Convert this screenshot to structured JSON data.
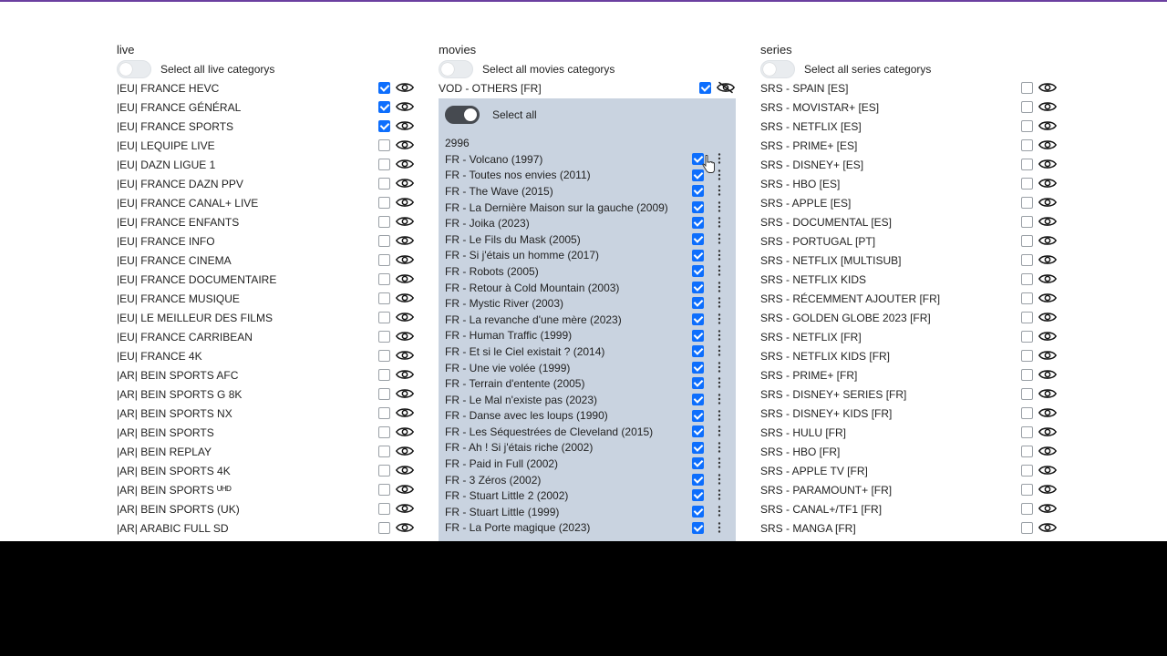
{
  "live": {
    "title": "live",
    "select_all_label": "Select all live categorys",
    "items": [
      {
        "label": "|EU| FRANCE HEVC",
        "checked": true
      },
      {
        "label": "|EU| FRANCE GÉNÉRAL",
        "checked": true
      },
      {
        "label": "|EU| FRANCE SPORTS",
        "checked": true
      },
      {
        "label": "|EU| LEQUIPE LIVE",
        "checked": false
      },
      {
        "label": "|EU| DAZN LIGUE 1",
        "checked": false
      },
      {
        "label": "|EU| FRANCE DAZN PPV",
        "checked": false
      },
      {
        "label": "|EU| FRANCE CANAL+ LIVE",
        "checked": false
      },
      {
        "label": "|EU| FRANCE ENFANTS",
        "checked": false
      },
      {
        "label": "|EU| FRANCE INFO",
        "checked": false
      },
      {
        "label": "|EU| FRANCE CINEMA",
        "checked": false
      },
      {
        "label": "|EU| FRANCE DOCUMENTAIRE",
        "checked": false
      },
      {
        "label": "|EU| FRANCE MUSIQUE",
        "checked": false
      },
      {
        "label": "|EU| LE MEILLEUR DES FILMS",
        "checked": false
      },
      {
        "label": "|EU| FRANCE CARRIBEAN",
        "checked": false
      },
      {
        "label": "|EU| FRANCE 4K",
        "checked": false
      },
      {
        "label": "|AR| BEIN SPORTS AFC",
        "checked": false
      },
      {
        "label": "|AR| BEIN SPORTS G 8K",
        "checked": false
      },
      {
        "label": "|AR| BEIN SPORTS NX",
        "checked": false
      },
      {
        "label": "|AR| BEIN SPORTS",
        "checked": false
      },
      {
        "label": "|AR| BEIN REPLAY",
        "checked": false
      },
      {
        "label": "|AR| BEIN SPORTS 4K",
        "checked": false
      },
      {
        "label": "|AR| BEIN SPORTS ᵁᴴᴰ",
        "checked": false
      },
      {
        "label": "|AR| BEIN SPORTS (UK)",
        "checked": false
      },
      {
        "label": "|AR| ARABIC FULL SD",
        "checked": false
      }
    ]
  },
  "movies": {
    "title": "movies",
    "select_all_label": "Select all movies categorys",
    "category": {
      "label": "VOD - OTHERS [FR]",
      "checked": true
    },
    "panel": {
      "select_all_label": "Select all",
      "count": "2996",
      "items": [
        "FR - Volcano (1997)",
        "FR - Toutes nos envies (2011)",
        "FR - The Wave (2015)",
        "FR - La Dernière Maison sur la gauche (2009)",
        "FR - Joika (2023)",
        "FR - Le Fils du Mask (2005)",
        "FR - Si j'étais un homme (2017)",
        "FR - Robots (2005)",
        "FR - Retour à Cold Mountain (2003)",
        "FR - Mystic River (2003)",
        "FR - La revanche d'une mère (2023)",
        "FR - Human Traffic (1999)",
        "FR - Et si le Ciel existait ? (2014)",
        "FR - Une vie volée (1999)",
        "FR - Terrain d'entente (2005)",
        "FR - Le Mal n'existe pas (2023)",
        "FR - Danse avec les loups (1990)",
        "FR - Les Séquestrées de Cleveland (2015)",
        "FR - Ah ! Si j'étais riche (2002)",
        "FR - Paid in Full (2002)",
        "FR - 3 Zéros (2002)",
        "FR - Stuart Little 2 (2002)",
        "FR - Stuart Little (1999)",
        "FR - La Porte magique (2023)"
      ]
    }
  },
  "series": {
    "title": "series",
    "select_all_label": "Select all series categorys",
    "items": [
      "SRS - SPAIN [ES]",
      "SRS - MOVISTAR+ [ES]",
      "SRS - NETFLIX [ES]",
      "SRS - PRIME+ [ES]",
      "SRS - DISNEY+ [ES]",
      "SRS - HBO [ES]",
      "SRS - APPLE [ES]",
      "SRS - DOCUMENTAL [ES]",
      "SRS - PORTUGAL [PT]",
      "SRS - NETFLIX [MULTISUB]",
      "SRS - NETFLIX KIDS",
      "SRS - RÉCEMMENT AJOUTER [FR]",
      "SRS - GOLDEN GLOBE 2023 [FR]",
      "SRS - NETFLIX [FR]",
      "SRS - NETFLIX KIDS [FR]",
      "SRS - PRIME+ [FR]",
      "SRS - DISNEY+ SERIES [FR]",
      "SRS - DISNEY+ KIDS [FR]",
      "SRS - HULU [FR]",
      "SRS - HBO [FR]",
      "SRS - APPLE TV [FR]",
      "SRS - PARAMOUNT+ [FR]",
      "SRS - CANAL+/TF1 [FR]",
      "SRS - MANGA [FR]"
    ]
  },
  "icons": {
    "eye": "eye-icon",
    "eye_off": "eye-off-icon",
    "kebab": "kebab-menu-icon"
  },
  "colors": {
    "accent": "#0d6efd",
    "panel_bg": "#c9d3e0",
    "top_bar": "#6b3fa0"
  }
}
